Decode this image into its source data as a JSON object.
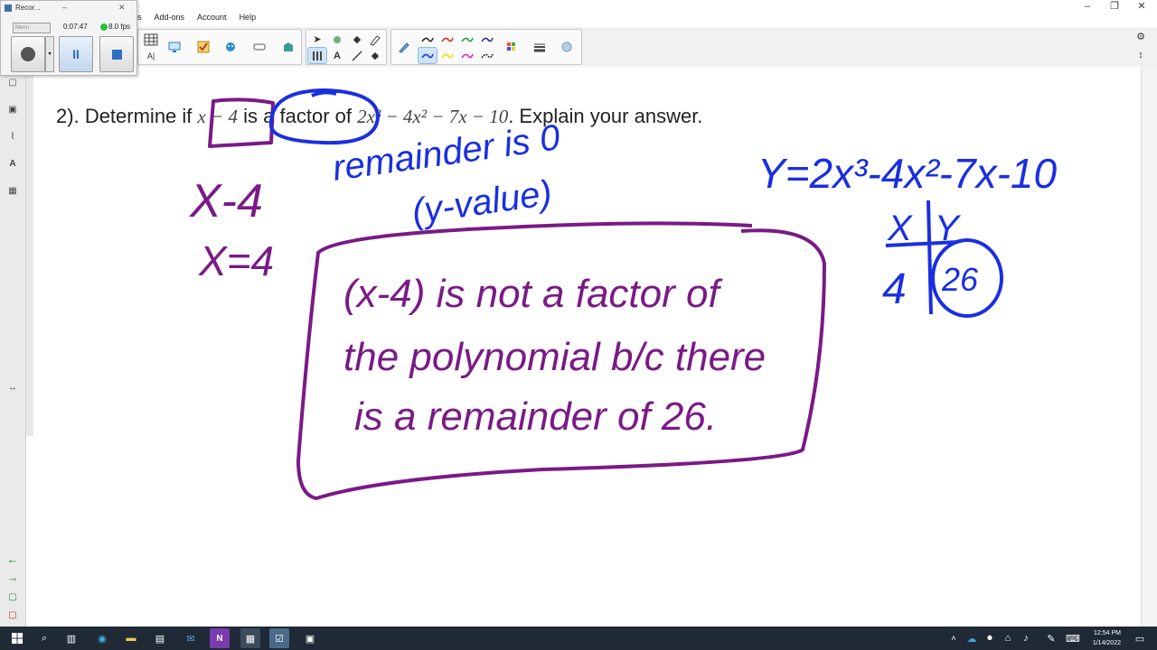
{
  "menu": [
    "ls",
    "Add-ons",
    "Account",
    "Help"
  ],
  "window_controls": [
    "–",
    "❐",
    "✕"
  ],
  "recorder": {
    "title": "Recor...",
    "elapsed": "0:07:47",
    "fps": "8.0 fps",
    "menu_label": "Menu"
  },
  "question": {
    "number": "2).",
    "prefix": "Determine if",
    "factor": "x − 4",
    "mid": "is a factor of",
    "poly": "2x³ − 4x² − 7x − 10",
    "suffix": ". Explain your answer."
  },
  "handwriting": {
    "x_minus_4": "X-4",
    "x_equals_4": "X=4",
    "remainder_note_line1": "remainder is 0",
    "remainder_note_line2": "(y-value)",
    "equation": "Y=2x³-4x²-7x-10",
    "table_x_header": "X",
    "table_y_header": "Y",
    "table_x_value": "4",
    "table_y_value": "26",
    "conclusion_line1": "(x-4) is not a factor of",
    "conclusion_line2": "the polynomial b/c there",
    "conclusion_line3": "is a remainder of 26."
  },
  "colors": {
    "purple_ink": "#7a1a86",
    "blue_ink": "#1a2fe0",
    "taskbar": "#1f2a36"
  },
  "clock": {
    "time": "12:54 PM",
    "date": "1/14/2022"
  }
}
